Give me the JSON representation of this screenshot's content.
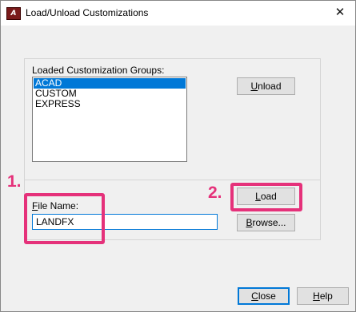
{
  "window": {
    "title": "Load/Unload Customizations",
    "close_glyph": "✕"
  },
  "groups": {
    "label": "Loaded Customization Groups:",
    "items": [
      {
        "label": "ACAD",
        "selected": true
      },
      {
        "label": "CUSTOM",
        "selected": false
      },
      {
        "label": "EXPRESS",
        "selected": false
      }
    ]
  },
  "buttons": {
    "unload": {
      "accel": "U",
      "rest": "nload"
    },
    "load": {
      "accel": "L",
      "rest": "oad"
    },
    "browse": {
      "accel": "B",
      "rest": "rowse..."
    },
    "close": {
      "accel": "C",
      "rest": "lose"
    },
    "help": {
      "accel": "H",
      "rest": "elp"
    }
  },
  "file": {
    "label_accel": "F",
    "label_rest": "ile Name:",
    "value": "LANDFX"
  },
  "annotations": {
    "step1": "1.",
    "step2": "2.",
    "color": "#e5317a"
  },
  "colors": {
    "accent": "#0078d7",
    "selection": "#0078d7",
    "dialog_bg": "#f0f0f0"
  },
  "icons": {
    "app": "autocad-app-icon",
    "close": "close-icon"
  }
}
